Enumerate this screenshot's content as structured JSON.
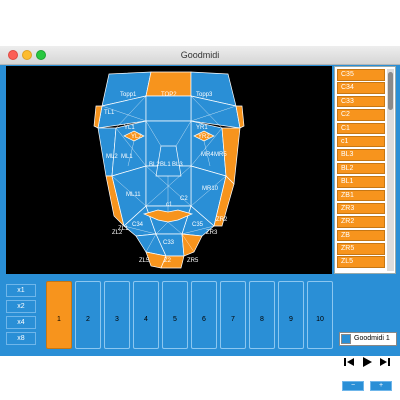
{
  "window": {
    "title": "Goodmidi"
  },
  "face": {
    "labels": [
      "Topp1",
      "TOP2",
      "Topp3",
      "YL1",
      "YR1",
      "YL2",
      "YR2",
      "TL1",
      "ML2",
      "ML1",
      "MR4",
      "MR5",
      "BL1",
      "BL2",
      "BL3",
      "MR10",
      "ML11",
      "c1",
      "C2",
      "ZR2",
      "ZL1",
      "C34",
      "C35",
      "ZL2",
      "ZR3",
      "C33",
      "ZL5",
      "Z2",
      "ZR5"
    ]
  },
  "params": {
    "items": [
      "C35",
      "C34",
      "C33",
      "C2",
      "C1",
      "c1",
      "BL3",
      "BL2",
      "BL1",
      "ZB1",
      "ZR3",
      "ZR2",
      "ZB",
      "ZR5",
      "ZL5"
    ]
  },
  "multipliers": [
    "x1",
    "x2",
    "x4",
    "x8"
  ],
  "pads": [
    {
      "label": "1",
      "active": true
    },
    {
      "label": "2",
      "active": false
    },
    {
      "label": "3",
      "active": false
    },
    {
      "label": "4",
      "active": false
    },
    {
      "label": "5",
      "active": false
    },
    {
      "label": "6",
      "active": false
    },
    {
      "label": "7",
      "active": false
    },
    {
      "label": "8",
      "active": false
    },
    {
      "label": "9",
      "active": false
    },
    {
      "label": "10",
      "active": false
    }
  ],
  "preset": {
    "name": "Goodmidi 1"
  },
  "buttons": {
    "minus": "−",
    "plus": "+"
  },
  "icons": {
    "prev": "skip-back-icon",
    "play": "play-icon",
    "next": "skip-forward-icon"
  },
  "colors": {
    "blue": "#2a8fd6",
    "orange": "#f7941d",
    "black": "#000000"
  }
}
